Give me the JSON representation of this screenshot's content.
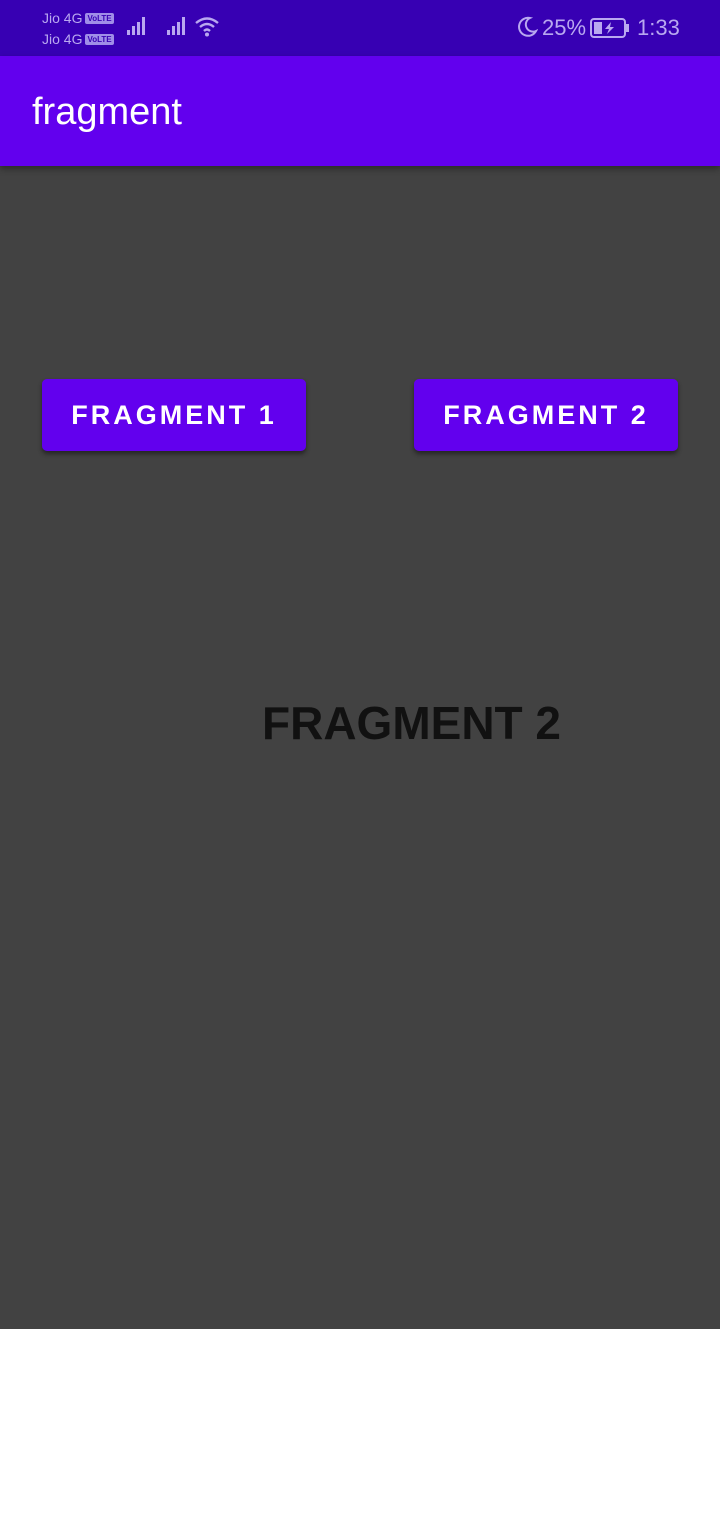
{
  "status_bar": {
    "carrier_1": "Jio 4G",
    "carrier_2": "Jio 4G",
    "volte_badge": "VoLTE",
    "battery_percent": "25%",
    "time": "1:33",
    "icons": [
      "signal-icon",
      "signal-icon",
      "wifi-icon",
      "moon-icon",
      "battery-charging-icon"
    ],
    "background_color": "#3700b3"
  },
  "app_bar": {
    "title": "fragment",
    "background_color": "#6200ee"
  },
  "content": {
    "buttons": [
      {
        "label": "FRAGMENT 1"
      },
      {
        "label": "FRAGMENT 2"
      }
    ],
    "fragment_text": "FRAGMENT 2",
    "background_color": "#424242"
  }
}
